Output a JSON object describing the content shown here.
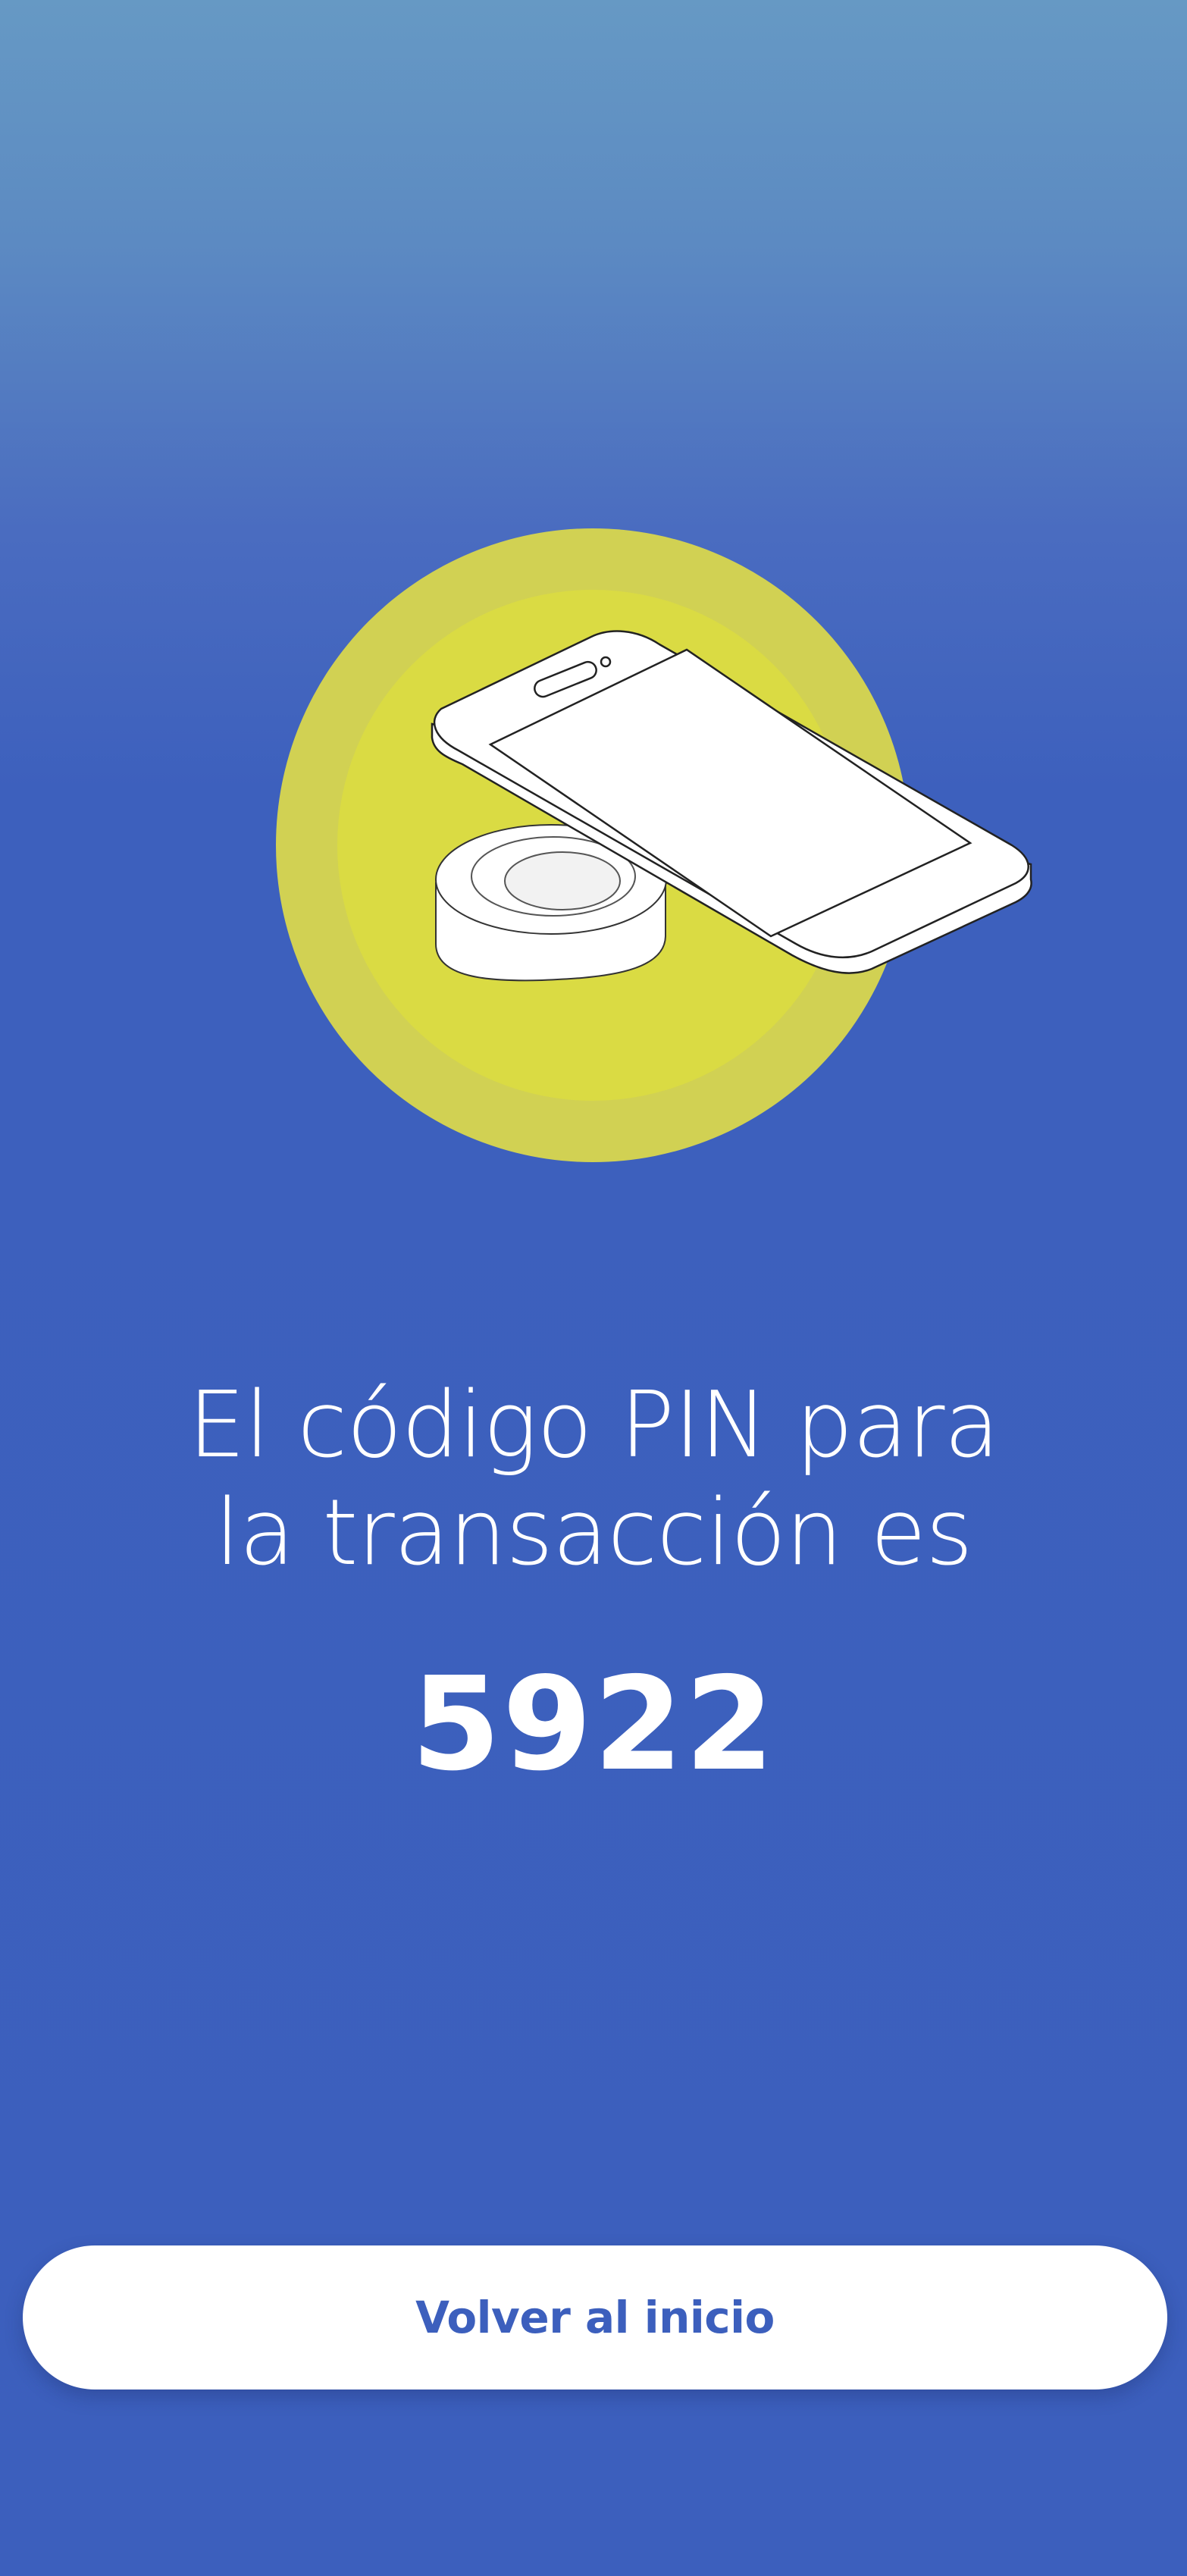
{
  "illustration": {
    "icon": "nfc-phone-tap-icon",
    "circle_outer_color": "#d1d153",
    "circle_inner_color": "#dadb43"
  },
  "message": {
    "line1": "El código PIN para",
    "line2": "la transacción es"
  },
  "pin": {
    "code": "5922"
  },
  "actions": {
    "home_button_label": "Volver al inicio"
  },
  "colors": {
    "background": "#3c5fbd",
    "button_text": "#3c5fbd",
    "button_bg": "#ffffff"
  }
}
